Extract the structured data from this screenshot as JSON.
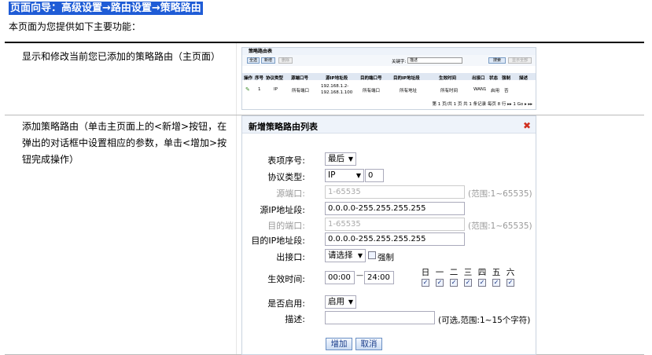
{
  "title": "页面向导：高级设置→路由设置→策略路由",
  "intro": "本页面为您提供如下主要功能：",
  "rows": [
    {
      "desc": "显示和修改当前您已添加的策略路由（主页面）"
    },
    {
      "desc": "添加策略路由（单击主页面上的<新增>按钮，在弹出的对话框中设置相应的参数，单击<增加>按钮完成操作）"
    }
  ],
  "mini": {
    "title": "策略路由表",
    "buttons": [
      "全选",
      "新增",
      "删除"
    ],
    "search_label": "关键字:",
    "search_value": "描述",
    "search_btn": "搜索",
    "show_all_btn": "显示全部",
    "headers": [
      "操作",
      "序号",
      "协议类型",
      "源端口号",
      "源IP地址段",
      "目的端口号",
      "目的IP地址段",
      "生效时间",
      "出接口",
      "状态",
      "强制",
      "描述"
    ],
    "row": [
      "",
      "1",
      "IP",
      "所有端口",
      "192.168.1.2-192.168.1.100",
      "所有端口",
      "所有地址",
      "所有时间",
      "WAN1",
      "启用",
      "否",
      ""
    ],
    "footer": "第 1 页/共 1 页 共 1 条记录 每页 8 行 ▸▸ 1 Go ▸ ▸▸"
  },
  "dialog": {
    "title": "新增策略路由列表",
    "fields": {
      "index_label": "表项序号:",
      "index_value": "最后",
      "proto_label": "协议类型:",
      "proto_value": "IP",
      "proto_num": "0",
      "src_port_label": "源端口:",
      "src_port_value": "1-65535",
      "src_port_hint": "(范围:1~65535)",
      "src_ip_label": "源IP地址段:",
      "src_ip_value": "0.0.0.0-255.255.255.255",
      "dst_port_label": "目的端口:",
      "dst_port_value": "1-65535",
      "dst_port_hint": "(范围:1~65535)",
      "dst_ip_label": "目的IP地址段:",
      "dst_ip_value": "0.0.0.0-255.255.255.255",
      "iface_label": "出接口:",
      "iface_value": "请选择",
      "force_label": "强制",
      "time_label": "生效时间:",
      "time_start": "00:00",
      "time_sep": "—",
      "time_end": "24:00",
      "days": [
        "日",
        "一",
        "二",
        "三",
        "四",
        "五",
        "六"
      ],
      "enable_label": "是否启用:",
      "enable_value": "启用",
      "desc_label": "描述:",
      "desc_value": "",
      "desc_hint": "(可选,范围:1~15个字符)",
      "add_btn": "增加",
      "cancel_btn": "取消"
    }
  }
}
